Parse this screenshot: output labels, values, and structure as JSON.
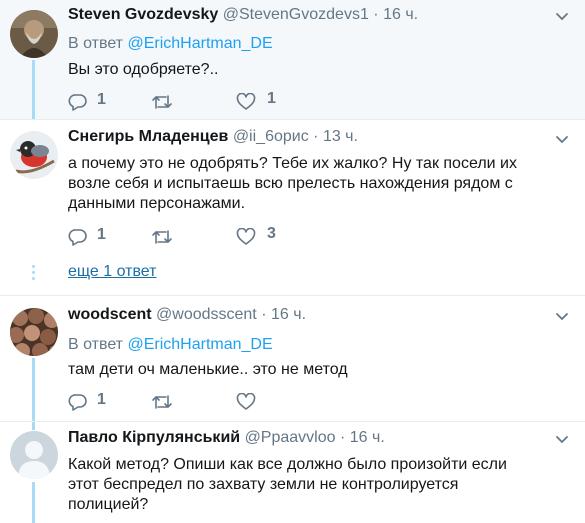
{
  "tweets": [
    {
      "name": "Steven Gvozdevsky",
      "handle": "@StevenGvozdevs1",
      "dot": "·",
      "time": "16 ч.",
      "reply_prefix": "В ответ",
      "reply_to": "@ErichHartman_DE",
      "text": "Вы это одобряете?..",
      "replies": "1",
      "retweets": "",
      "likes": "1"
    },
    {
      "name": "Снегирь Младенцев",
      "handle": "@ii_6орис",
      "dot": "·",
      "time": "13 ч.",
      "text_lines": [
        "а почему это не одобрять? Тебе их жалко? Ну так посели их",
        "возле себя и испытаешь всю прелесть нахождения рядом с",
        "данными персонажами."
      ],
      "replies": "1",
      "retweets": "",
      "likes": "3",
      "more_replies": "еще 1 ответ"
    },
    {
      "name": "woodscent",
      "handle": "@woodsscent",
      "dot": "·",
      "time": "16 ч.",
      "reply_prefix": "В ответ",
      "reply_to": "@ErichHartman_DE",
      "text": "там дети оч маленькие.. это не метод",
      "replies": "1",
      "retweets": "",
      "likes": ""
    },
    {
      "name": "Павло Кірпулянський",
      "handle": "@Ppaavvloo",
      "dot": "·",
      "time": "16 ч.",
      "text_lines": [
        "Какой метод? Опиши как все должно было произойти если",
        "этот беспредел по захвату земли не контролируется",
        "полицией?"
      ]
    }
  ],
  "colors": {
    "accent": "#1da1f2",
    "muted": "#657786",
    "thread_line": "#a8dbf5",
    "highlight_bg": "#f5f8fa"
  }
}
